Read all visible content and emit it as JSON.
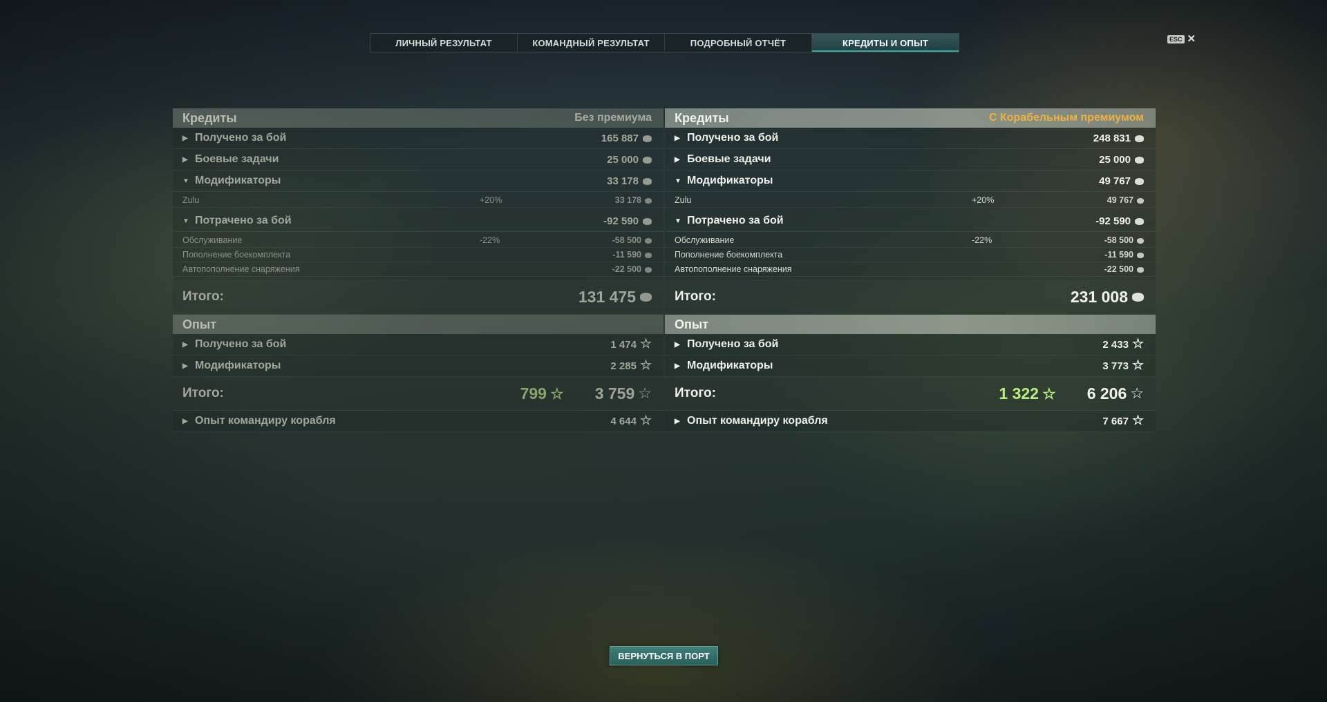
{
  "tabs": [
    {
      "label": "ЛИЧНЫЙ РЕЗУЛЬТАТ"
    },
    {
      "label": "КОМАНДНЫЙ РЕЗУЛЬТАТ"
    },
    {
      "label": "ПОДРОБНЫЙ ОТЧЁТ"
    },
    {
      "label": "КРЕДИТЫ И ОПЫТ"
    }
  ],
  "active_tab": "КРЕДИТЫ И ОПЫТ",
  "esc": {
    "badge": "ESC",
    "close": "✕"
  },
  "icons": {
    "credits": "coin-icon",
    "xp": "star-icon",
    "expanded": "triangle-down-icon",
    "collapsed": "triangle-right-icon"
  },
  "colors": {
    "premium_label": "#f0b040",
    "premium_xp": "#b8f080",
    "active_tab_accent": "#3fa9a0"
  },
  "left": {
    "credits": {
      "title": "Кредиты",
      "subtitle": "Без премиума",
      "earned": {
        "label": "Получено за бой",
        "value": "165 887"
      },
      "missions": {
        "label": "Боевые задачи",
        "value": "25 000"
      },
      "modifiers": {
        "label": "Модификаторы",
        "value": "33 178"
      },
      "zulu": {
        "label": "Zulu",
        "pct": "+20%",
        "value": "33 178"
      },
      "spent": {
        "label": "Потрачено за бой",
        "value": "-92 590"
      },
      "service": {
        "label": "Обслуживание",
        "pct": "-22%",
        "value": "-58 500"
      },
      "ammo": {
        "label": "Пополнение боекомплекта",
        "value": "-11 590"
      },
      "consumables": {
        "label": "Автопополнение снаряжения",
        "value": "-22 500"
      },
      "total": {
        "label": "Итого:",
        "value": "131 475"
      }
    },
    "xp": {
      "title": "Опыт",
      "earned": {
        "label": "Получено за бой",
        "value": "1 474"
      },
      "modifiers": {
        "label": "Модификаторы",
        "value": "2 285"
      },
      "total": {
        "label": "Итого:",
        "free": "799",
        "value": "3 759"
      },
      "commander": {
        "label": "Опыт командиру корабля",
        "value": "4 644"
      }
    }
  },
  "right": {
    "credits": {
      "title": "Кредиты",
      "subtitle": "С Корабельным премиумом",
      "earned": {
        "label": "Получено за бой",
        "value": "248 831"
      },
      "missions": {
        "label": "Боевые задачи",
        "value": "25 000"
      },
      "modifiers": {
        "label": "Модификаторы",
        "value": "49 767"
      },
      "zulu": {
        "label": "Zulu",
        "pct": "+20%",
        "value": "49 767"
      },
      "spent": {
        "label": "Потрачено за бой",
        "value": "-92 590"
      },
      "service": {
        "label": "Обслуживание",
        "pct": "-22%",
        "value": "-58 500"
      },
      "ammo": {
        "label": "Пополнение боекомплекта",
        "value": "-11 590"
      },
      "consumables": {
        "label": "Автопополнение снаряжения",
        "value": "-22 500"
      },
      "total": {
        "label": "Итого:",
        "value": "231 008"
      }
    },
    "xp": {
      "title": "Опыт",
      "earned": {
        "label": "Получено за бой",
        "value": "2 433"
      },
      "modifiers": {
        "label": "Модификаторы",
        "value": "3 773"
      },
      "total": {
        "label": "Итого:",
        "free": "1 322",
        "value": "6 206"
      },
      "commander": {
        "label": "Опыт командиру корабля",
        "value": "7 667"
      }
    }
  },
  "return_button": {
    "label": "ВЕРНУТЬСЯ В ПОРТ"
  }
}
